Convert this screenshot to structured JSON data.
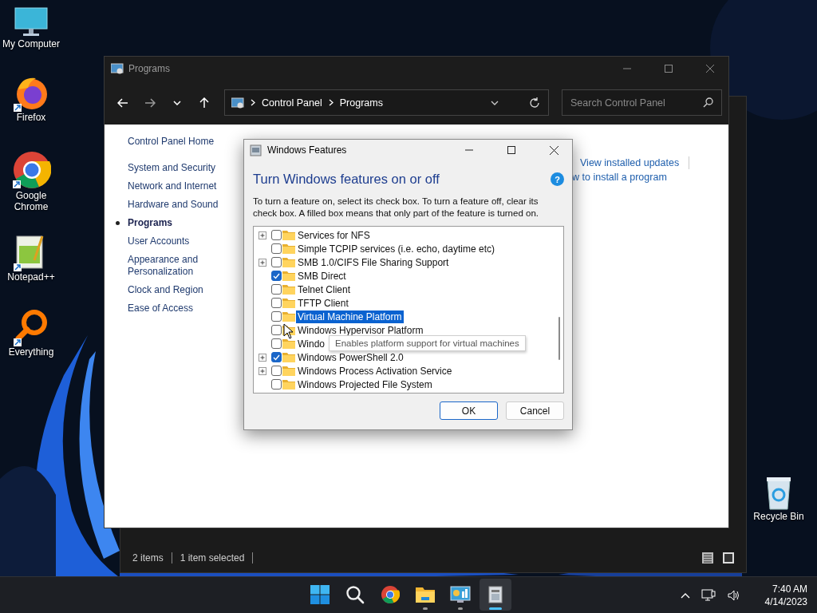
{
  "desktop_icons": [
    {
      "label": "My Computer",
      "kind": "computer"
    },
    {
      "label": "Firefox",
      "kind": "firefox"
    },
    {
      "label": "Google Chrome",
      "kind": "chrome"
    },
    {
      "label": "Notepad++",
      "kind": "notepad"
    },
    {
      "label": "Everything",
      "kind": "everything"
    }
  ],
  "recycle_bin": {
    "label": "Recycle Bin"
  },
  "back_window": {
    "status": [
      "2 items",
      "1 item selected"
    ]
  },
  "explorer": {
    "title": "Programs",
    "breadcrumb": [
      "Control Panel",
      "Programs"
    ],
    "search": {
      "placeholder": "Search Control Panel"
    },
    "nav": [
      {
        "label": "Control Panel Home",
        "selected": false
      },
      {
        "label": "System and Security",
        "selected": false
      },
      {
        "label": "Network and Internet",
        "selected": false
      },
      {
        "label": "Hardware and Sound",
        "selected": false
      },
      {
        "label": "Programs",
        "selected": true
      },
      {
        "label": "User Accounts",
        "selected": false
      },
      {
        "label": "Appearance and Personalization",
        "selected": false
      },
      {
        "label": "Clock and Region",
        "selected": false
      },
      {
        "label": "Ease of Access",
        "selected": false
      }
    ],
    "links": [
      "View installed updates",
      "w to install a program"
    ]
  },
  "dialog": {
    "title": "Windows Features",
    "heading": "Turn Windows features on or off",
    "help_glyph": "?",
    "description": "To turn a feature on, select its check box. To turn a feature off, clear its check box. A filled box means that only part of the feature is turned on.",
    "features": [
      {
        "label": "Services for NFS",
        "expandable": true,
        "checked": false,
        "selected": false
      },
      {
        "label": "Simple TCPIP services (i.e. echo, daytime etc)",
        "expandable": false,
        "checked": false,
        "selected": false
      },
      {
        "label": "SMB 1.0/CIFS File Sharing Support",
        "expandable": true,
        "checked": false,
        "selected": false
      },
      {
        "label": "SMB Direct",
        "expandable": false,
        "checked": true,
        "selected": false
      },
      {
        "label": "Telnet Client",
        "expandable": false,
        "checked": false,
        "selected": false
      },
      {
        "label": "TFTP Client",
        "expandable": false,
        "checked": false,
        "selected": false
      },
      {
        "label": "Virtual Machine Platform",
        "expandable": false,
        "checked": false,
        "selected": true
      },
      {
        "label": "Windows Hypervisor Platform",
        "expandable": false,
        "checked": false,
        "selected": false
      },
      {
        "label": "Windo",
        "expandable": false,
        "checked": false,
        "selected": false
      },
      {
        "label": "Windows PowerShell 2.0",
        "expandable": true,
        "checked": true,
        "selected": false
      },
      {
        "label": "Windows Process Activation Service",
        "expandable": true,
        "checked": false,
        "selected": false
      },
      {
        "label": "Windows Projected File System",
        "expandable": false,
        "checked": false,
        "selected": false
      }
    ],
    "tooltip": "Enables platform support for virtual machines",
    "buttons": [
      {
        "label": "OK",
        "default": true
      },
      {
        "label": "Cancel",
        "default": false
      }
    ]
  },
  "taskbar": {
    "apps": [
      {
        "kind": "start",
        "running": false,
        "active": false
      },
      {
        "kind": "search",
        "running": false,
        "active": false
      },
      {
        "kind": "chrome",
        "running": false,
        "active": false
      },
      {
        "kind": "explorer",
        "running": true,
        "active": false
      },
      {
        "kind": "control",
        "running": true,
        "active": false
      },
      {
        "kind": "features",
        "running": true,
        "active": true
      }
    ],
    "time": "7:40 AM",
    "date": "4/14/2023"
  }
}
